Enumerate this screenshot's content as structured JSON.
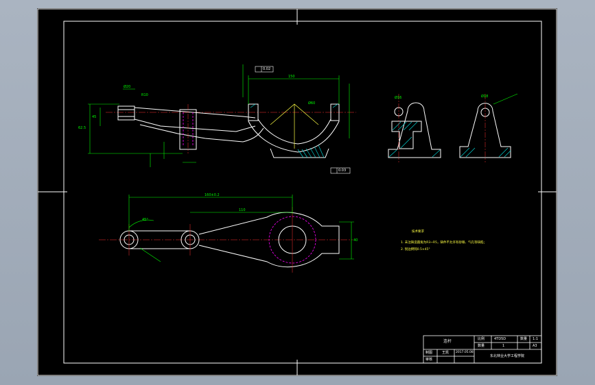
{
  "title_block": {
    "name": "连杆",
    "scale_label": "比例",
    "scale_value": "1:1",
    "qty_label": "数量",
    "qty_value": "1",
    "drawing_no": "4TD5D",
    "sheet": "A3",
    "designer_label": "制图",
    "designer": "王凯",
    "date": "2017.05.08",
    "reviewer_label": "审核",
    "school": "东北林业大学工程学院"
  },
  "tech_requirements": {
    "title": "技术要求",
    "items": [
      "1. 未注铸造圆角为R3~R5，铸件不允许有砂眼、气孔等缺陷；",
      "2. 锐边倒钝0.5×45°"
    ]
  },
  "dimensions": {
    "top_span": "150",
    "top_left_a": "Ø20",
    "top_left_b": "R10",
    "hub_dia": "Ø60",
    "left_height": "45",
    "overall_height": "62.5",
    "lower_span": "160±0.2",
    "lower_mid": "110",
    "lower_height": "40",
    "small_angle": "45°",
    "right_small_1": "Ø16",
    "right_small_2": "Ø18",
    "tol_box_1": "0.02",
    "tol_box_2": "0.03"
  },
  "colors": {
    "outline": "#ffffff",
    "dimension": "#00ff00",
    "center": "#ff3030",
    "hidden": "#ff00ff",
    "hatch": "#00d0d0",
    "annotation": "#ffff44"
  }
}
